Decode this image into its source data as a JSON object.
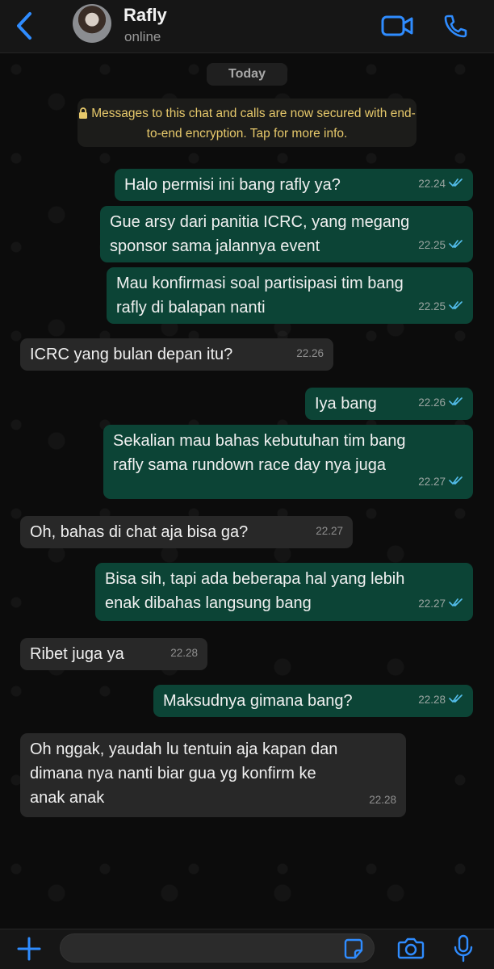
{
  "header": {
    "contact_name": "Rafly",
    "status": "online",
    "icons": [
      "chevron-left-icon",
      "video-call-icon",
      "phone-call-icon"
    ],
    "accent": "#2f8cff"
  },
  "chat": {
    "day_label": "Today",
    "encryption_notice": "Messages to this chat and calls are now secured with end-to-end encryption. Tap for more info.",
    "messages": [
      {
        "dir": "out",
        "line1": "Halo permisi ini bang rafly ya?",
        "line2": "",
        "line3": "",
        "time": "22.24"
      },
      {
        "dir": "out",
        "line1": "Gue arsy dari panitia ICRC, yang megang",
        "line2": "sponsor sama jalannya event",
        "line3": "",
        "time": "22.25"
      },
      {
        "dir": "out",
        "line1": "Mau konfirmasi soal partisipasi tim bang",
        "line2": "rafly di balapan nanti",
        "line3": "",
        "time": "22.25"
      },
      {
        "dir": "in",
        "line1": "ICRC yang bulan depan itu?",
        "line2": "",
        "line3": "",
        "time": "22.26"
      },
      {
        "dir": "out",
        "line1": "Iya bang",
        "line2": "",
        "line3": "",
        "time": "22.26"
      },
      {
        "dir": "out",
        "line1": "Sekalian mau bahas kebutuhan tim bang",
        "line2": "rafly sama rundown race day nya juga",
        "line3": "",
        "time": "22.27"
      },
      {
        "dir": "in",
        "line1": "Oh, bahas di chat aja bisa ga?",
        "line2": "",
        "line3": "",
        "time": "22.27"
      },
      {
        "dir": "out",
        "line1": "Bisa sih, tapi ada beberapa hal yang lebih",
        "line2": "enak dibahas langsung bang",
        "line3": "",
        "time": "22.27"
      },
      {
        "dir": "in",
        "line1": "Ribet juga ya",
        "line2": "",
        "line3": "",
        "time": "22.28"
      },
      {
        "dir": "out",
        "line1": "Maksudnya gimana bang?",
        "line2": "",
        "line3": "",
        "time": "22.28"
      },
      {
        "dir": "in",
        "line1": "Oh nggak, yaudah lu tentuin aja kapan dan",
        "line2": "dimana nya nanti biar gua yg konfirm ke",
        "line3": "anak anak",
        "time": "22.28"
      }
    ],
    "colors": {
      "outgoing": "#0c4436",
      "incoming": "#282828",
      "read_tick": "#53bdeb"
    }
  },
  "composer": {
    "input_value": "",
    "icons": [
      "plus-icon",
      "sticker-icon",
      "camera-icon",
      "microphone-icon"
    ]
  }
}
